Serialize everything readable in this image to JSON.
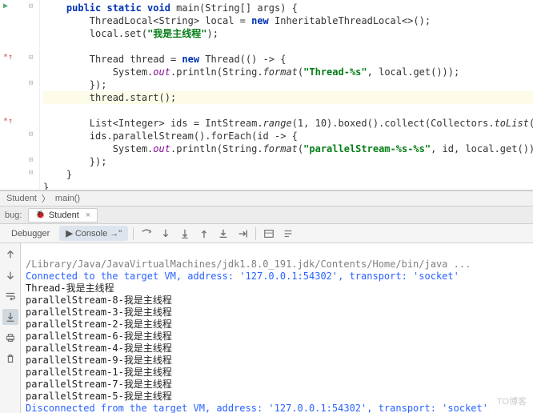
{
  "code": {
    "l1a": "public static void",
    "l1b": " main(String[] args) {",
    "l2a": "    ThreadLocal<String> local = ",
    "l2b": "new",
    "l2c": " InheritableThreadLocal<>();",
    "l3a": "    local.set(",
    "l3b": "\"我是主线程\"",
    "l3c": ");",
    "l4": "",
    "l5a": "    Thread thread = ",
    "l5b": "new",
    "l5c": " Thread(() -> {",
    "l6a": "        System.",
    "l6b": "out",
    "l6c": ".println(String.",
    "l6d": "format",
    "l6e": "(",
    "l6f": "\"Thread-%s\"",
    "l6g": ", local.get()));",
    "l7": "    });",
    "l8": "    thread.start();",
    "l9": "",
    "l10a": "    List<Integer> ids = IntStream.",
    "l10b": "range",
    "l10c": "(",
    "l10d": "1",
    "l10e": ", ",
    "l10f": "10",
    "l10g": ").boxed().collect(Collectors.",
    "l10h": "toList",
    "l10i": "());",
    "l11a": "    ids.parallelStream().forEach(id -> {",
    "l12a": "        System.",
    "l12b": "out",
    "l12c": ".println(String.",
    "l12d": "format",
    "l12e": "(",
    "l12f": "\"parallelStream-%s-%s\"",
    "l12g": ", id, local.get()));",
    "l13": "    });",
    "l14": "}"
  },
  "breadcrumb": {
    "class": "Student",
    "sep": "〉",
    "method": "main()"
  },
  "debug": {
    "label": "bug:",
    "tab": "Student"
  },
  "toolbar": {
    "debugger": "Debugger",
    "console": "Console",
    "arrow": "→\""
  },
  "console": {
    "path": "/Library/Java/JavaVirtualMachines/jdk1.8.0_191.jdk/Contents/Home/bin/java ...",
    "connected": "Connected to the target VM, address: '127.0.0.1:54302', transport: 'socket'",
    "lines": [
      "Thread-我是主线程",
      "parallelStream-8-我是主线程",
      "parallelStream-3-我是主线程",
      "parallelStream-2-我是主线程",
      "parallelStream-6-我是主线程",
      "parallelStream-4-我是主线程",
      "parallelStream-9-我是主线程",
      "parallelStream-1-我是主线程",
      "parallelStream-7-我是主线程",
      "parallelStream-5-我是主线程"
    ],
    "disconnected": "Disconnected from the target VM, address: '127.0.0.1:54302', transport: 'socket'"
  },
  "watermark": "TO博客"
}
